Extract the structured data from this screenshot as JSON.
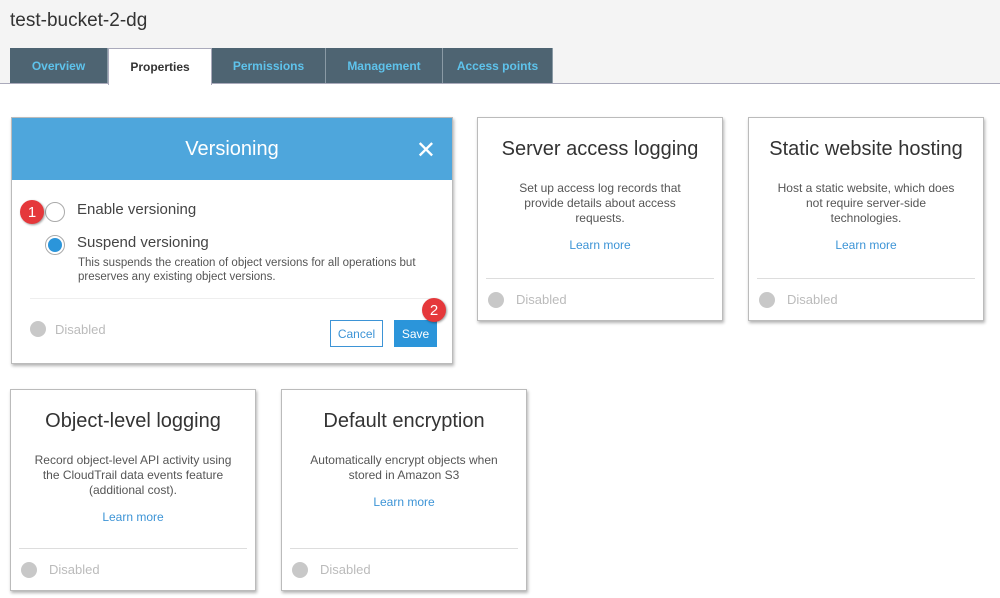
{
  "page_title": "test-bucket-2-dg",
  "tabs": [
    "Overview",
    "Properties",
    "Permissions",
    "Management",
    "Access points"
  ],
  "versioning": {
    "title": "Versioning",
    "option_enable": "Enable versioning",
    "option_suspend": "Suspend versioning",
    "suspend_desc": "This suspends the creation of object versions for all operations but preserves any existing object versions.",
    "status": "Disabled",
    "cancel": "Cancel",
    "save": "Save",
    "badge1": "1",
    "badge2": "2",
    "selected": "suspend"
  },
  "cards": [
    {
      "title": "Server access logging",
      "desc": "Set up access log records that provide details about access requests.",
      "link": "Learn more",
      "status": "Disabled"
    },
    {
      "title": "Static website hosting",
      "desc": "Host a static website, which does not require server-side technologies.",
      "link": "Learn more",
      "status": "Disabled"
    },
    {
      "title": "Object-level logging",
      "desc": "Record object-level API activity using the CloudTrail data events feature (additional cost).",
      "link": "Learn more",
      "status": "Disabled"
    },
    {
      "title": "Default encryption",
      "desc": "Automatically encrypt objects when stored in Amazon S3",
      "link": "Learn more",
      "status": "Disabled"
    }
  ]
}
